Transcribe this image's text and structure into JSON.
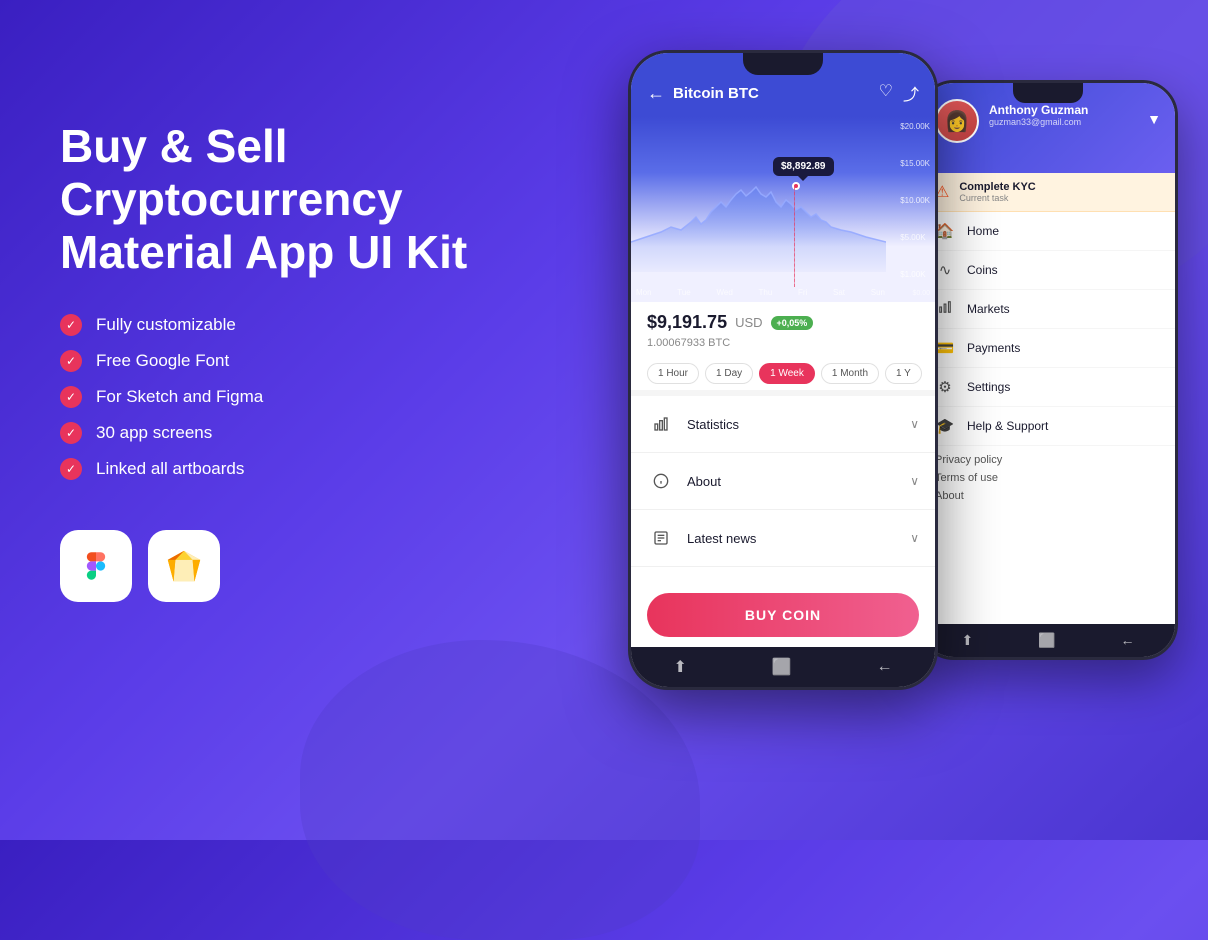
{
  "background": {
    "gradient_start": "#3a1fc1",
    "gradient_end": "#4a35d0"
  },
  "left": {
    "title": "Buy & Sell\nCryptocurrency\nMaterial App UI Kit",
    "features": [
      "Fully customizable",
      "Free Google Font",
      "For Sketch and Figma",
      "30 app screens",
      "Linked all artboards"
    ],
    "tools": [
      "figma-logo",
      "sketch-logo"
    ]
  },
  "phone_main": {
    "header": {
      "back_label": "←",
      "title": "Bitcoin BTC",
      "heart_icon": "♡",
      "share_icon": "⤴"
    },
    "chart": {
      "tooltip_value": "$8,892.89",
      "y_labels": [
        "$20.00K",
        "$15.00K",
        "$10.00K",
        "$5.00K",
        "$1.00K"
      ],
      "x_labels": [
        "Mon",
        "Tue",
        "Wed",
        "Thu",
        "Fri",
        "Sat",
        "Sun"
      ],
      "zero_label": "$0.00"
    },
    "price": {
      "value": "$9,191.75",
      "currency": "USD",
      "btc": "1.00067933 BTC",
      "change": "+0,05%"
    },
    "time_filters": [
      {
        "label": "1 Hour",
        "active": false
      },
      {
        "label": "1 Day",
        "active": false
      },
      {
        "label": "1 Week",
        "active": true
      },
      {
        "label": "1 Month",
        "active": false
      },
      {
        "label": "1 Y",
        "active": false
      }
    ],
    "menu_items": [
      {
        "icon": "📊",
        "label": "Statistics"
      },
      {
        "icon": "ℹ️",
        "label": "About"
      },
      {
        "icon": "📰",
        "label": "Latest news"
      }
    ],
    "buy_button": "BUY COIN",
    "nav_items": [
      "⬆",
      "⬜",
      "←"
    ]
  },
  "phone_secondary": {
    "user": {
      "name": "Anthony Guzman",
      "email": "guzman33@gmail.com"
    },
    "kyc": {
      "title": "Complete KYC",
      "subtitle": "Current task"
    },
    "nav_items": [
      {
        "icon": "🏠",
        "label": "Home"
      },
      {
        "icon": "📈",
        "label": "Coins"
      },
      {
        "icon": "📊",
        "label": "Markets"
      },
      {
        "icon": "💳",
        "label": "Payments"
      },
      {
        "icon": "⚙️",
        "label": "Settings"
      },
      {
        "icon": "🎓",
        "label": "Help & Support"
      }
    ],
    "footer_links": [
      "Privacy policy",
      "Terms of use",
      "About"
    ],
    "bottom_nav": [
      "⬆",
      "⬜",
      "←"
    ]
  }
}
